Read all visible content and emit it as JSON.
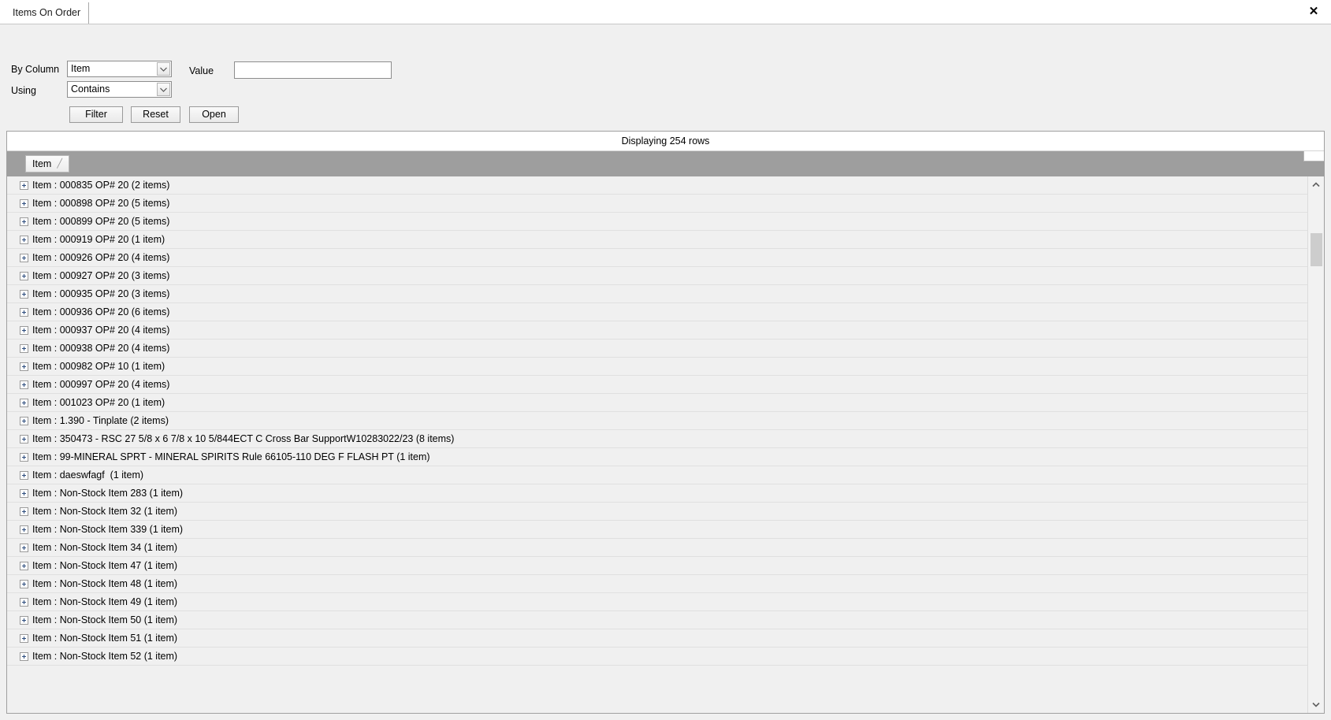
{
  "window": {
    "tab_label": "Items On Order",
    "close_label": "✕"
  },
  "filter": {
    "by_column_label": "By Column",
    "using_label": "Using",
    "value_label": "Value",
    "by_column_value": "Item",
    "using_value": "Contains",
    "value_input": "",
    "value_placeholder": "",
    "buttons": {
      "filter": "Filter",
      "reset": "Reset",
      "open": "Open"
    }
  },
  "grid": {
    "status_text": "Displaying 254 rows",
    "group_column_label": "Item",
    "sort_glyph": "╱",
    "rows": [
      "Item : 000835 OP# 20 (2 items)",
      "Item : 000898 OP# 20 (5 items)",
      "Item : 000899 OP# 20 (5 items)",
      "Item : 000919 OP# 20 (1 item)",
      "Item : 000926 OP# 20 (4 items)",
      "Item : 000927 OP# 20 (3 items)",
      "Item : 000935 OP# 20 (3 items)",
      "Item : 000936 OP# 20 (6 items)",
      "Item : 000937 OP# 20 (4 items)",
      "Item : 000938 OP# 20 (4 items)",
      "Item : 000982 OP# 10 (1 item)",
      "Item : 000997 OP# 20 (4 items)",
      "Item : 001023 OP# 20 (1 item)",
      "Item : 1.390 - Tinplate (2 items)",
      "Item : 350473 - RSC 27 5/8 x 6 7/8 x 10 5/844ECT C Cross Bar SupportW10283022/23 (8 items)",
      "Item : 99-MINERAL SPRT - MINERAL SPIRITS Rule 66105-110 DEG F FLASH PT (1 item)",
      "Item : daeswfagf  (1 item)",
      "Item : Non-Stock Item 283 (1 item)",
      "Item : Non-Stock Item 32 (1 item)",
      "Item : Non-Stock Item 339 (1 item)",
      "Item : Non-Stock Item 34 (1 item)",
      "Item : Non-Stock Item 47 (1 item)",
      "Item : Non-Stock Item 48 (1 item)",
      "Item : Non-Stock Item 49 (1 item)",
      "Item : Non-Stock Item 50 (1 item)",
      "Item : Non-Stock Item 51 (1 item)",
      "Item : Non-Stock Item 52 (1 item)"
    ]
  },
  "colors": {
    "group_bar": "#9e9e9e",
    "row_bg": "#f0f0f0",
    "panel_bg": "#f0f0f0",
    "scroll_thumb": "#cdcdcd"
  }
}
